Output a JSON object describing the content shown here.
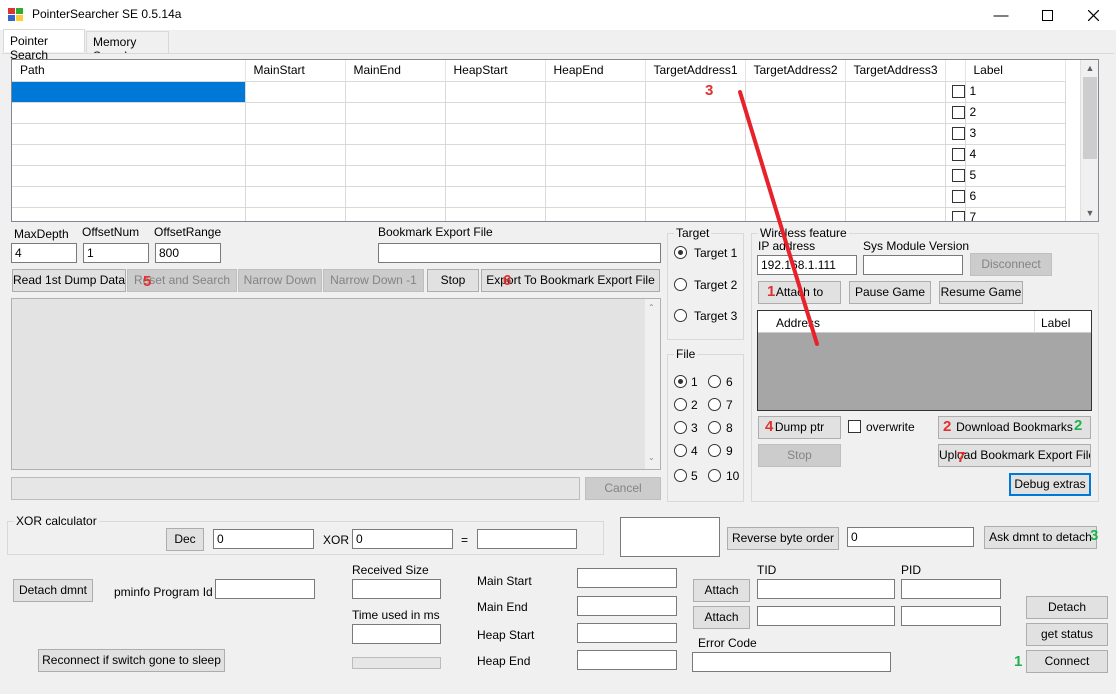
{
  "window": {
    "title": "PointerSearcher SE 0.5.14a"
  },
  "tabs": [
    "Pointer Search",
    "Memory Search"
  ],
  "grid": {
    "columns": [
      "Path",
      "MainStart",
      "MainEnd",
      "HeapStart",
      "HeapEnd",
      "TargetAddress1",
      "TargetAddress2",
      "TargetAddress3",
      "",
      "Label"
    ],
    "row_numbers": [
      "1",
      "2",
      "3",
      "4",
      "5",
      "6",
      "7"
    ]
  },
  "search": {
    "maxdepth_label": "MaxDepth",
    "maxdepth_value": "4",
    "offsetnum_label": "OffsetNum",
    "offsetnum_value": "1",
    "offsetrange_label": "OffsetRange",
    "offsetrange_value": "800",
    "bookmark_label": "Bookmark Export File",
    "bookmark_value": "",
    "buttons": {
      "read": "Read 1st Dump Data",
      "reset": "Reset and Search",
      "narrow": "Narrow Down",
      "narrow1": "Narrow Down -1",
      "stop": "Stop",
      "export": "Export To Bookmark Export File",
      "cancel": "Cancel"
    }
  },
  "target": {
    "group_label": "Target",
    "options": [
      "Target 1",
      "Target 2",
      "Target 3"
    ],
    "selected": "Target 1"
  },
  "file": {
    "group_label": "File",
    "options": [
      "1",
      "2",
      "3",
      "4",
      "5",
      "6",
      "7",
      "8",
      "9",
      "10"
    ],
    "selected": "1"
  },
  "wireless": {
    "group_label": "Wireless feature",
    "ip_label": "IP address",
    "ip_value": "192.168.1.111",
    "sysmod_label": "Sys Module Version",
    "sysmod_value": "",
    "disconnect": "Disconnect",
    "attach": "Attach to",
    "pause": "Pause Game",
    "resume": "Resume Game",
    "list_columns": [
      "Address",
      "Label"
    ],
    "dump_ptr": "Dump ptr",
    "overwrite": "overwrite",
    "download": "Download Bookmarks",
    "stop": "Stop",
    "upload": "Upload Bookmark Export File",
    "debug": "Debug extras"
  },
  "xor": {
    "group_label": "XOR calculator",
    "dec": "Dec",
    "input_value": "0",
    "xor_label": "XOR",
    "xor_value": "0",
    "eq": "=",
    "result": "",
    "reverse": "Reverse byte order",
    "reverse_value": "0",
    "ask": "Ask dmnt to detach"
  },
  "bottom": {
    "detach_dmnt": "Detach dmnt",
    "pminfo_label": "pminfo Program Id",
    "pminfo_value": "",
    "received_label": "Received Size",
    "time_label": "Time used in ms",
    "main_start": "Main Start",
    "main_end": "Main End",
    "heap_start": "Heap Start",
    "heap_end": "Heap End",
    "attach": "Attach",
    "tid_label": "TID",
    "pid_label": "PID",
    "error_label": "Error Code",
    "detach": "Detach",
    "get_status": "get status",
    "connect": "Connect",
    "reconnect": "Reconnect if switch gone to sleep"
  },
  "annotations": {
    "red": [
      "3",
      "5",
      "6",
      "1",
      "4",
      "2",
      "7"
    ],
    "green": [
      "2",
      "3",
      "1"
    ],
    "colors": {
      "red": "#e03030",
      "green": "#22b14c",
      "selection": "#0078d7"
    }
  }
}
